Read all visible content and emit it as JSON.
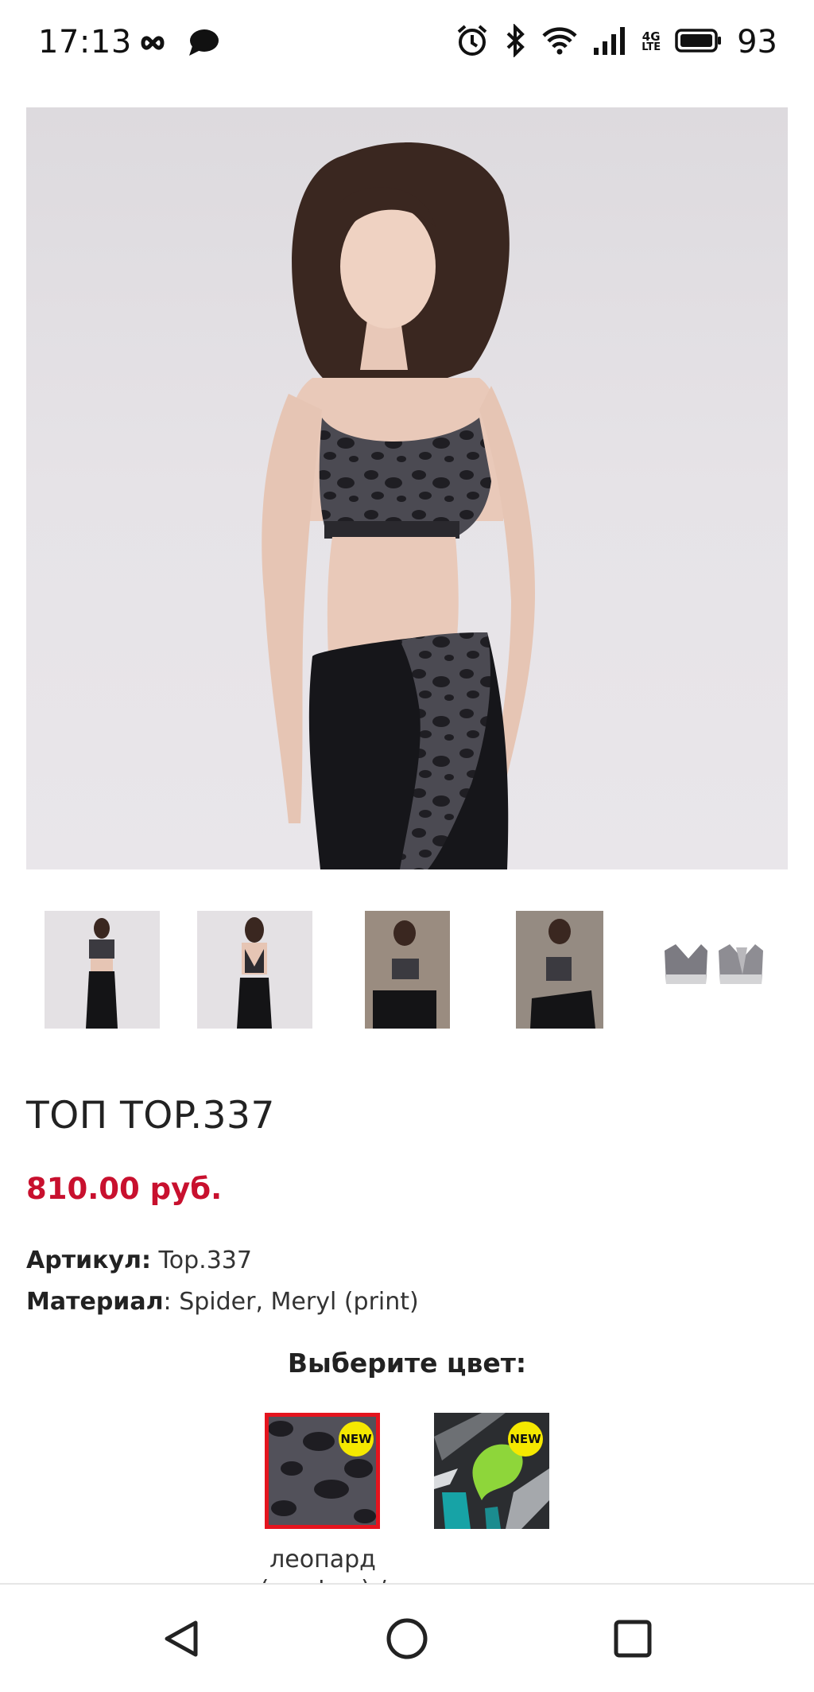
{
  "status_bar": {
    "time": "17:13",
    "left_icons": [
      "infinity-icon",
      "chat-bubble-icon"
    ],
    "right_icons": [
      "alarm-icon",
      "bluetooth-icon",
      "wifi-icon",
      "cellular-signal-icon",
      "4g-lte-icon",
      "battery-icon"
    ],
    "network_label_top": "4G",
    "network_label_bottom": "LTE",
    "battery": "93"
  },
  "product": {
    "title": "ТОП TOP.337",
    "price": "810.00 руб.",
    "article_label": "Артикул:",
    "article_value": " Top.337",
    "material_label": "Материал",
    "material_value": ": Spider, Meryl (print)"
  },
  "thumbnails": [
    "front-view",
    "back-view",
    "seated-view",
    "side-kneel-view",
    "flat-lay-view"
  ],
  "color_section": {
    "heading": "Выберите цвет:",
    "swatches": [
      {
        "pattern": "leopard-graphite",
        "badge": "NEW",
        "selected": true,
        "caption": "леопард (графит) /"
      },
      {
        "pattern": "abstract-green",
        "badge": "NEW",
        "selected": false
      }
    ]
  },
  "colors": {
    "price": "#c8102e",
    "selected_outline": "#e4141e",
    "new_badge": "#f5e800"
  },
  "nav": [
    "back-icon",
    "home-icon",
    "recents-icon"
  ]
}
